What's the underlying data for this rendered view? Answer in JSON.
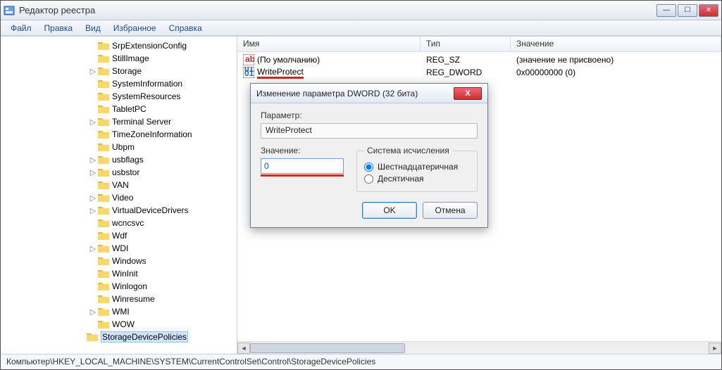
{
  "window": {
    "title": "Редактор реестра"
  },
  "menu": {
    "file": "Файл",
    "edit": "Правка",
    "view": "Вид",
    "fav": "Избранное",
    "help": "Справка"
  },
  "tree": {
    "items": [
      "SrpExtensionConfig",
      "StillImage",
      "Storage",
      "SystemInformation",
      "SystemResources",
      "TabletPC",
      "Terminal Server",
      "TimeZoneInformation",
      "Ubpm",
      "usbflags",
      "usbstor",
      "VAN",
      "Video",
      "VirtualDeviceDrivers",
      "wcncsvc",
      "Wdf",
      "WDI",
      "Windows",
      "WinInit",
      "Winlogon",
      "Winresume",
      "WMI",
      "WOW",
      "StorageDevicePolicies"
    ],
    "selected_index": 23
  },
  "list": {
    "headers": {
      "name": "Имя",
      "type": "Тип",
      "value": "Значение"
    },
    "rows": [
      {
        "name": "(По умолчанию)",
        "type": "REG_SZ",
        "value": "(значение не присвоено)",
        "icon": "ab"
      },
      {
        "name": "WriteProtect",
        "type": "REG_DWORD",
        "value": "0x00000000 (0)",
        "icon": "num",
        "underline": true
      }
    ]
  },
  "dialog": {
    "title": "Изменение параметра DWORD (32 бита)",
    "param_label": "Параметр:",
    "param_value": "WriteProtect",
    "value_label": "Значение:",
    "value_input": "0",
    "base_legend": "Система исчисления",
    "radio_hex": "Шестнадцатеричная",
    "radio_dec": "Десятичная",
    "ok": "OK",
    "cancel": "Отмена"
  },
  "status": {
    "path": "Компьютер\\HKEY_LOCAL_MACHINE\\SYSTEM\\CurrentControlSet\\Control\\StorageDevicePolicies"
  }
}
